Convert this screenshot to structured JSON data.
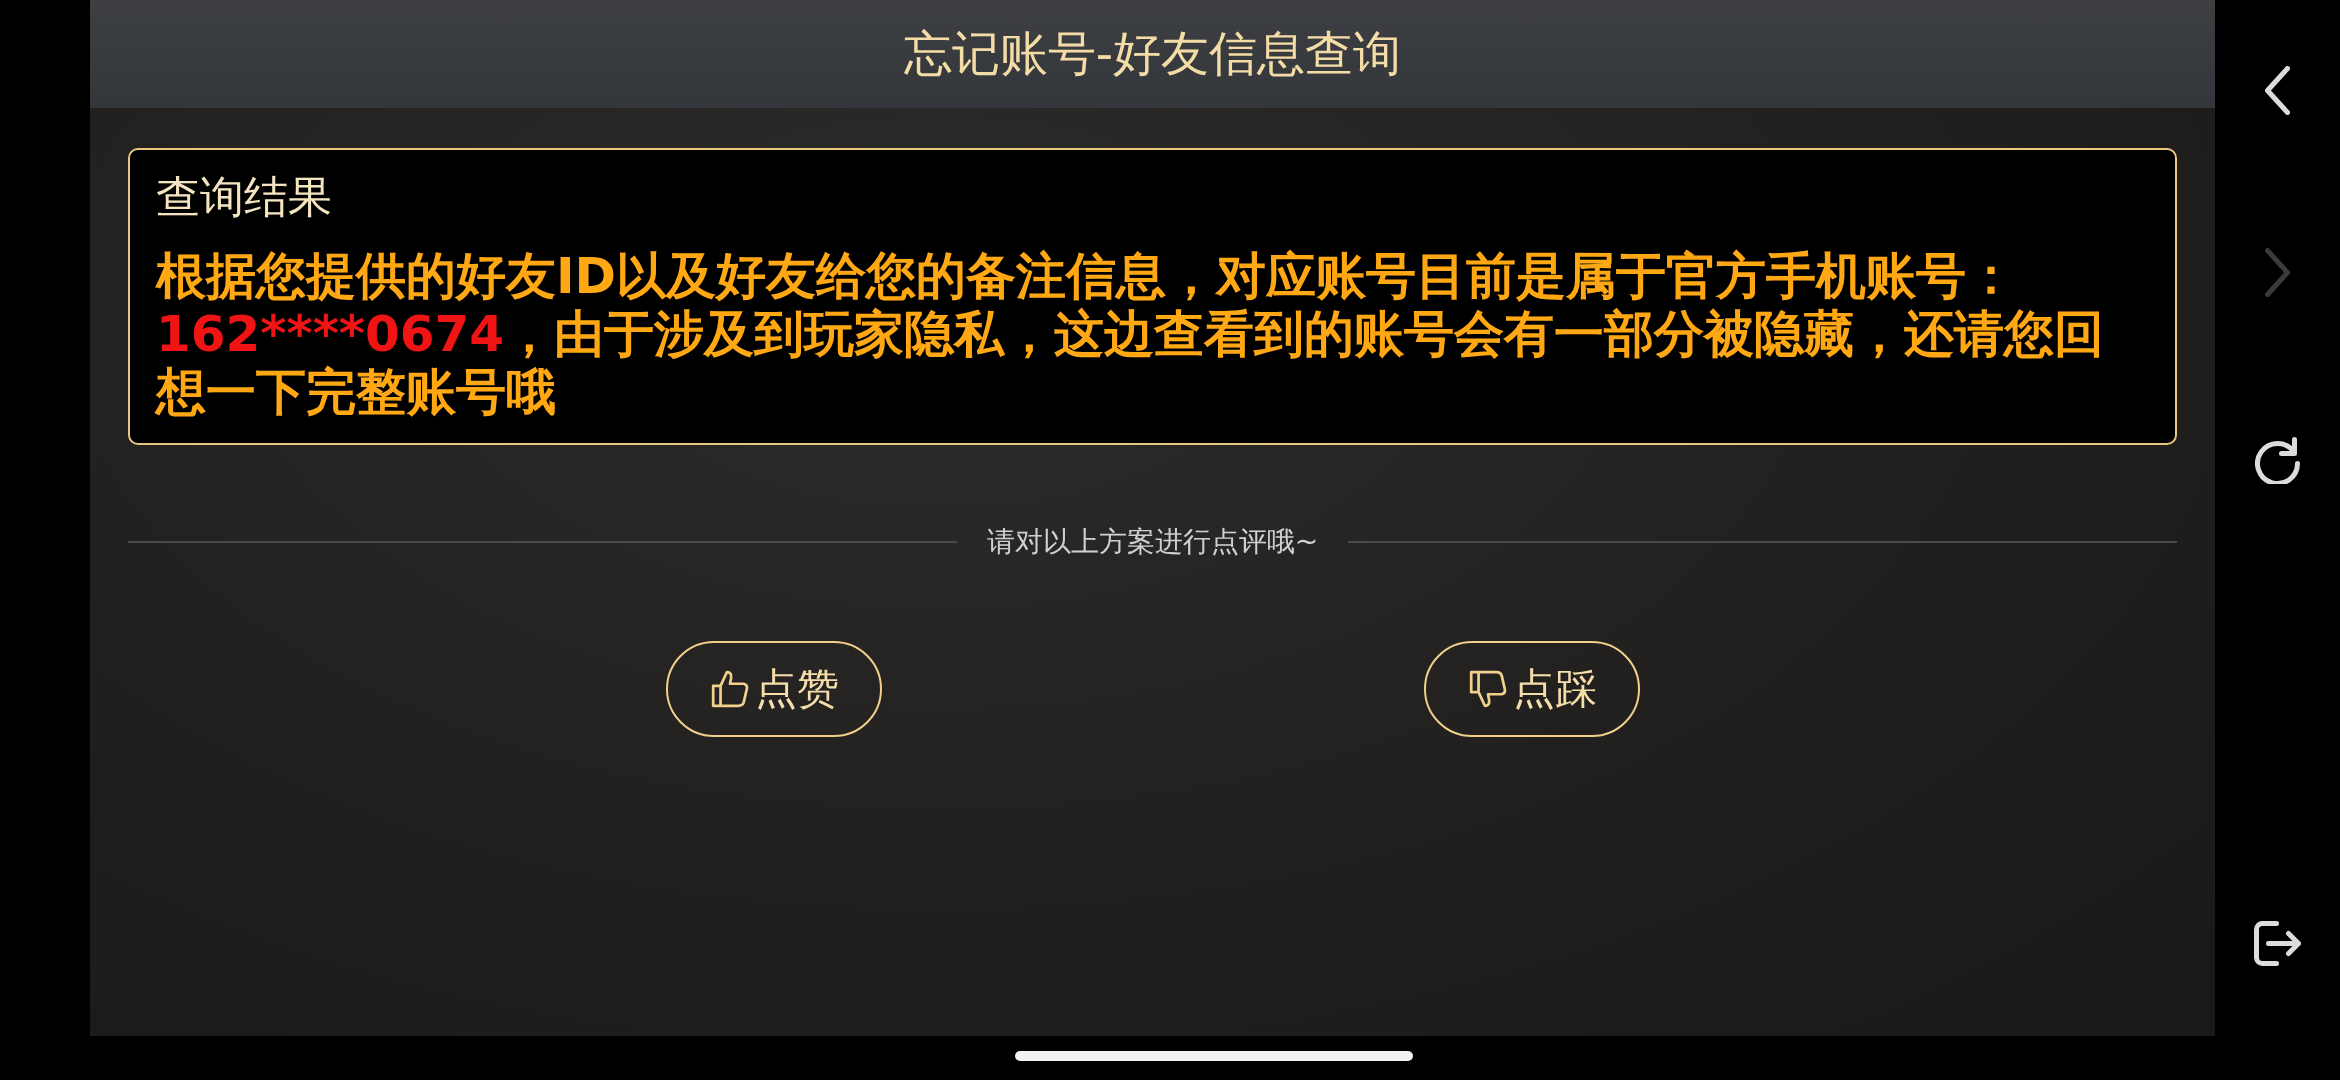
{
  "header": {
    "title": "忘记账号-好友信息查询"
  },
  "result_card": {
    "title": "查询结果",
    "message": [
      {
        "text": "根据您提供的好友ID以及好友给您的备注信息，对应账号目前是属于官方手机账号：",
        "color": "#ffa814"
      },
      {
        "text": "162****0674",
        "color": "#f01414"
      },
      {
        "text": "，由于涉及到玩家隐私，这边查看到的账号会有一部分被隐藏，还请您回想一下完整账号哦",
        "color": "#ffa814"
      }
    ]
  },
  "rating": {
    "prompt": "请对以上方案进行点评哦~",
    "buttons": [
      {
        "kind": "like",
        "label": "点赞"
      },
      {
        "kind": "dislike",
        "label": "点踩"
      }
    ]
  },
  "side_nav": [
    {
      "kind": "back",
      "disabled": false
    },
    {
      "kind": "forward",
      "disabled": true
    },
    {
      "kind": "refresh",
      "disabled": false
    },
    {
      "kind": "exit",
      "disabled": false
    }
  ]
}
